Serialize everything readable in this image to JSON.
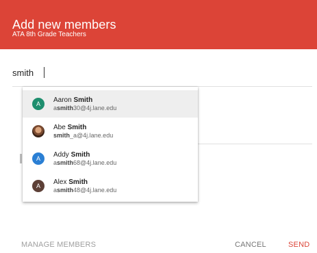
{
  "header": {
    "title": "Add new members",
    "subtitle": "ATA 8th Grade Teachers",
    "color": "#dc4437"
  },
  "search": {
    "value": "smith",
    "placeholder": ""
  },
  "suggestions": [
    {
      "first_name": "Aaron",
      "last_name": "Smith",
      "email_prefix": "a",
      "email_match": "smith",
      "email_suffix": "30@4j.lane.edu",
      "avatar_letter": "A",
      "avatar_color": "#1e8e6e",
      "highlighted": true
    },
    {
      "first_name": "Abe",
      "last_name": "Smith",
      "email_prefix": "",
      "email_match": "smith",
      "email_suffix": "_a@4j.lane.edu",
      "avatar_icon": "user-photo-icon",
      "highlighted": false
    },
    {
      "first_name": "Addy",
      "last_name": "Smith",
      "email_prefix": "a",
      "email_match": "smith",
      "email_suffix": "68@4j.lane.edu",
      "avatar_letter": "A",
      "avatar_color": "#2a7fd4",
      "highlighted": false
    },
    {
      "first_name": "Alex",
      "last_name": "Smith",
      "email_prefix": "a",
      "email_match": "smith",
      "email_suffix": "48@4j.lane.edu",
      "avatar_letter": "A",
      "avatar_color": "#5d4037",
      "highlighted": false
    }
  ],
  "footer": {
    "manage_label": "MANAGE MEMBERS",
    "cancel_label": "CANCEL",
    "send_label": "SEND"
  }
}
